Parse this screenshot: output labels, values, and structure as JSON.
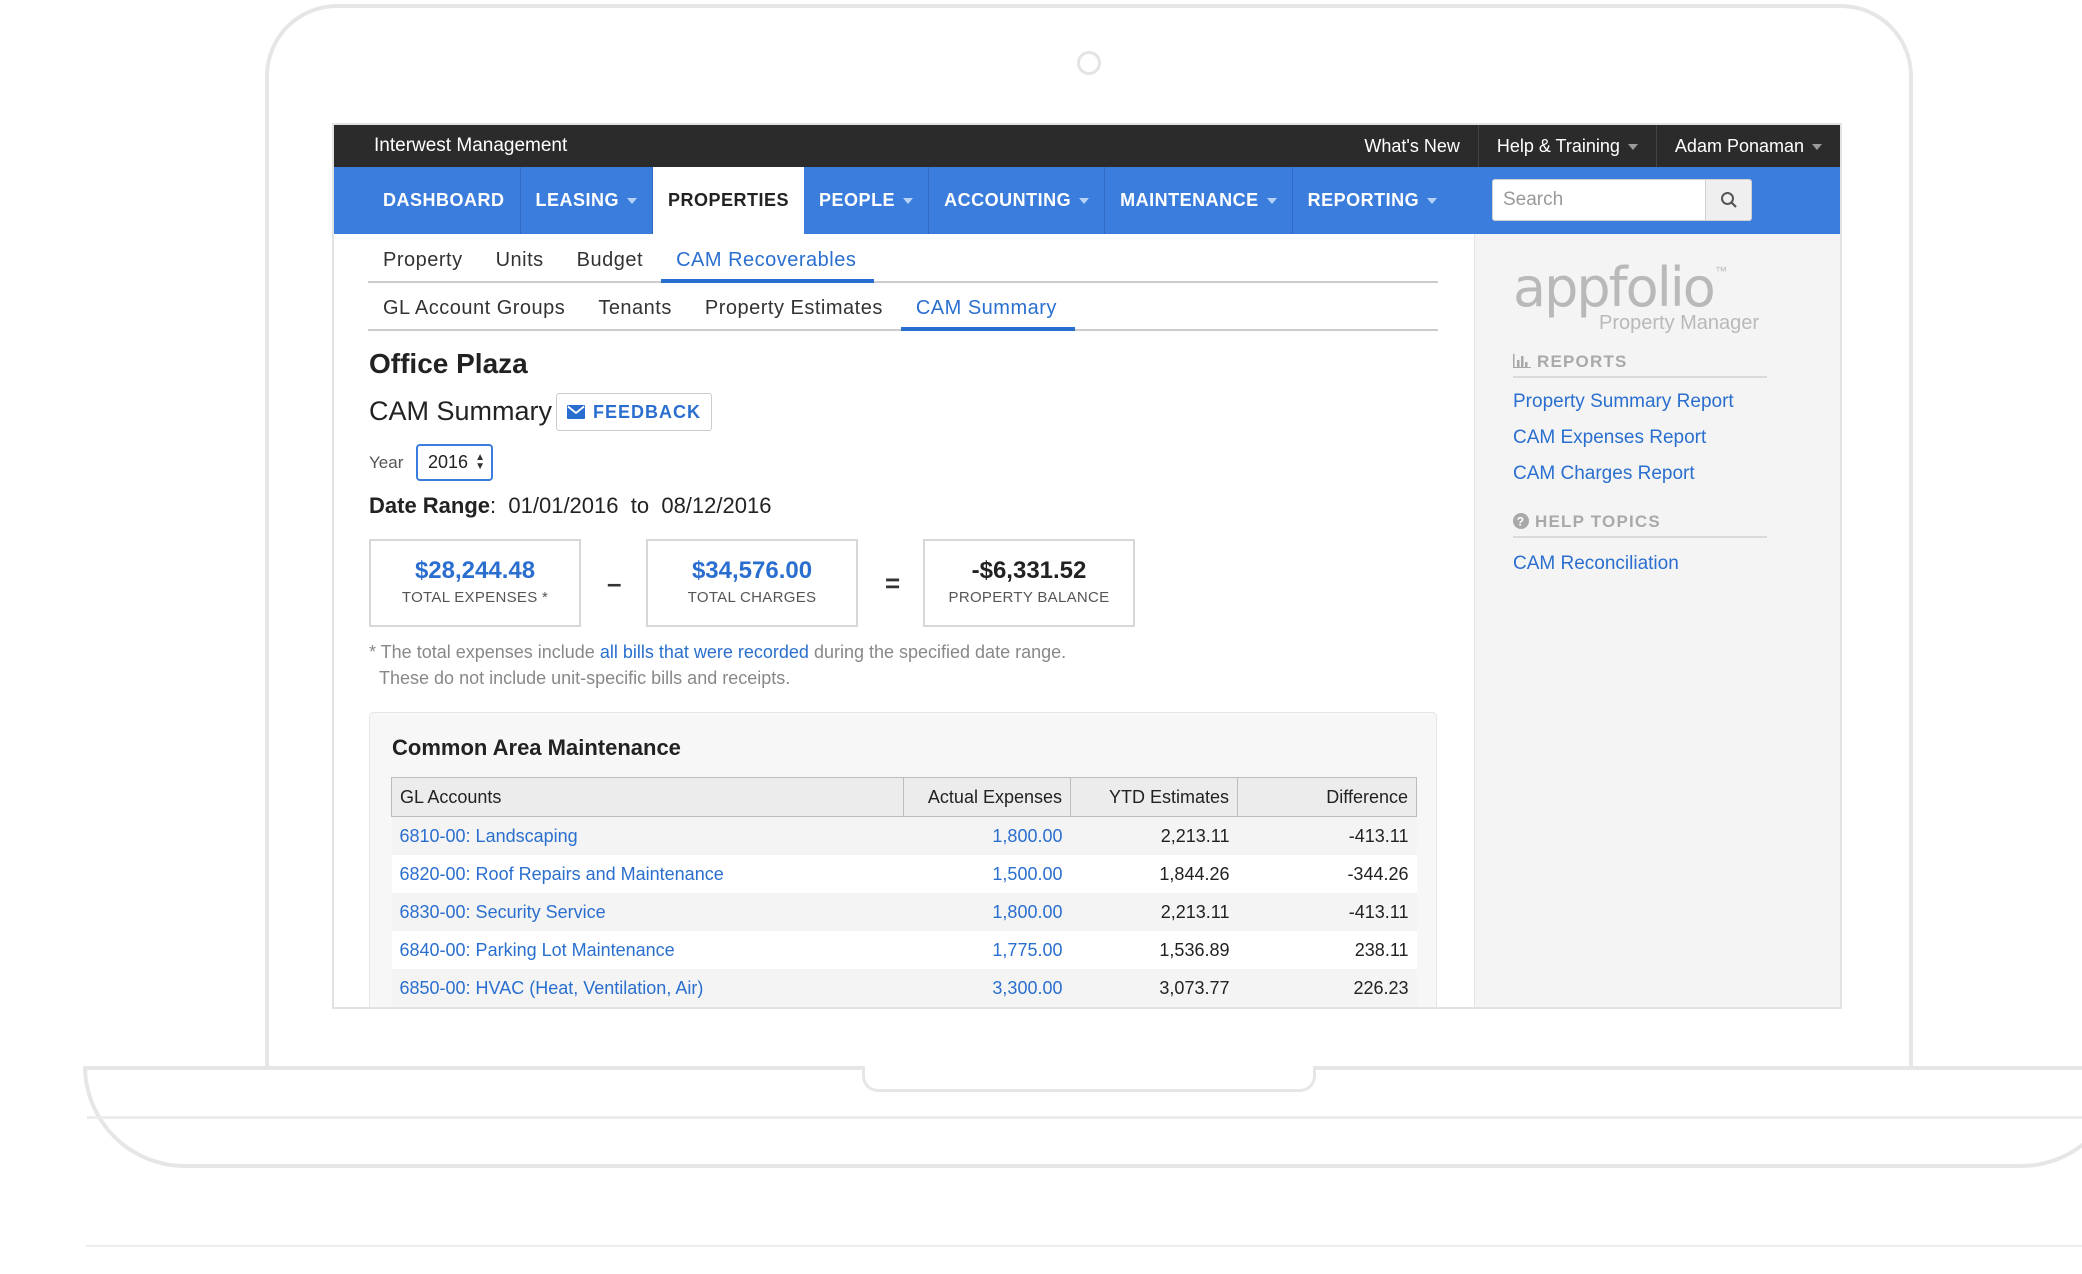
{
  "app": {
    "brand": "Interwest Management",
    "top_links": [
      "What's New",
      "Help & Training",
      "Adam Ponaman"
    ]
  },
  "nav": {
    "items": [
      "DASHBOARD",
      "LEASING",
      "PROPERTIES",
      "PEOPLE",
      "ACCOUNTING",
      "MAINTENANCE",
      "REPORTING"
    ],
    "active": "PROPERTIES",
    "search_placeholder": "Search"
  },
  "subtabs": {
    "row1": [
      "Property",
      "Units",
      "Budget",
      "CAM Recoverables"
    ],
    "row2": [
      "GL Account Groups",
      "Tenants",
      "Property Estimates",
      "CAM Summary"
    ]
  },
  "page": {
    "title": "Office Plaza",
    "subtitle": "CAM Summary",
    "feedback_label": "FEEDBACK",
    "year_label": "Year",
    "year_value": "2016",
    "date_range_label": "Date Range",
    "date_from": "01/01/2016",
    "date_to_word": "to",
    "date_to": "08/12/2016"
  },
  "stats": {
    "total_expenses": "$28,244.48",
    "total_expenses_label": "TOTAL EXPENSES *",
    "minus": "–",
    "total_charges": "$34,576.00",
    "total_charges_label": "TOTAL CHARGES",
    "equals": "=",
    "property_balance": "-$6,331.52",
    "property_balance_label": "PROPERTY BALANCE"
  },
  "footnote": {
    "prefix": "* The total expenses include ",
    "link": "all bills that were recorded",
    "suffix": " during the specified date range.",
    "line2": "These do not include unit-specific bills and receipts."
  },
  "cam": {
    "title": "Common Area Maintenance",
    "columns": [
      "GL Accounts",
      "Actual Expenses",
      "YTD Estimates",
      "Difference"
    ],
    "rows": [
      [
        "6810-00: Landscaping",
        "1,800.00",
        "2,213.11",
        "-413.11"
      ],
      [
        "6820-00: Roof Repairs and Maintenance",
        "1,500.00",
        "1,844.26",
        "-344.26"
      ],
      [
        "6830-00: Security Service",
        "1,800.00",
        "2,213.11",
        "-413.11"
      ],
      [
        "6840-00: Parking Lot Maintenance",
        "1,775.00",
        "1,536.89",
        "238.11"
      ],
      [
        "6850-00: HVAC (Heat, Ventilation, Air)",
        "3,300.00",
        "3,073.77",
        "226.23"
      ]
    ]
  },
  "sidebar": {
    "logo_text": "appfolio",
    "logo_tm": "™",
    "logo_sub": "Property Manager",
    "reports_heading": "REPORTS",
    "reports": [
      "Property Summary Report",
      "CAM Expenses Report",
      "CAM Charges Report"
    ],
    "help_heading": "HELP TOPICS",
    "help": [
      "CAM Reconciliation"
    ]
  },
  "colors": {
    "nav_blue": "#3b7ddd",
    "link_blue": "#2a6fcf",
    "topbar": "#2b2b2b"
  }
}
